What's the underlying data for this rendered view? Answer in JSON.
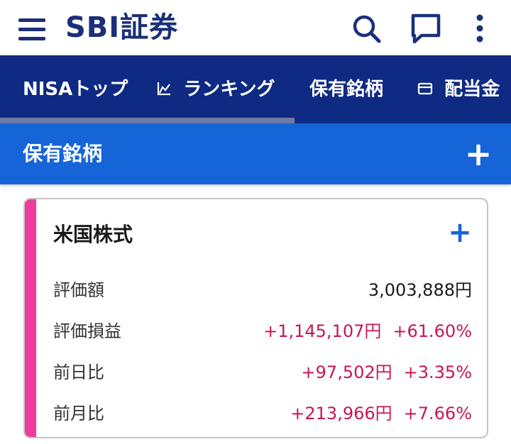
{
  "header": {
    "logo_text": "SBI証券",
    "brand_color": "#1b2f7a",
    "icons": [
      "menu-icon",
      "search-icon",
      "chat-icon",
      "more-vert-icon"
    ]
  },
  "nav": {
    "tabs": [
      {
        "label": "NISAトップ",
        "icon": "",
        "active": true
      },
      {
        "label": "ランキング",
        "icon": "chart-icon",
        "active": false
      },
      {
        "label": "保有銘柄",
        "icon": "",
        "active": false
      },
      {
        "label": "配当金",
        "icon": "card-icon",
        "active": false
      }
    ],
    "background": "#0f2a83"
  },
  "section": {
    "title": "保有銘柄",
    "add_label": "+",
    "background": "#1565d8"
  },
  "card": {
    "title": "米国株式",
    "add_label": "+",
    "accent_color": "#ef3c9c",
    "rows": [
      {
        "label": "評価額",
        "amount": "3,003,888円",
        "percent": ""
      },
      {
        "label": "評価損益",
        "amount": "+1,145,107円",
        "percent": "+61.60%"
      },
      {
        "label": "前日比",
        "amount": "+97,502円",
        "percent": "+3.35%"
      },
      {
        "label": "前月比",
        "amount": "+213,966円",
        "percent": "+7.66%"
      }
    ],
    "positive_color": "#c8174f"
  }
}
